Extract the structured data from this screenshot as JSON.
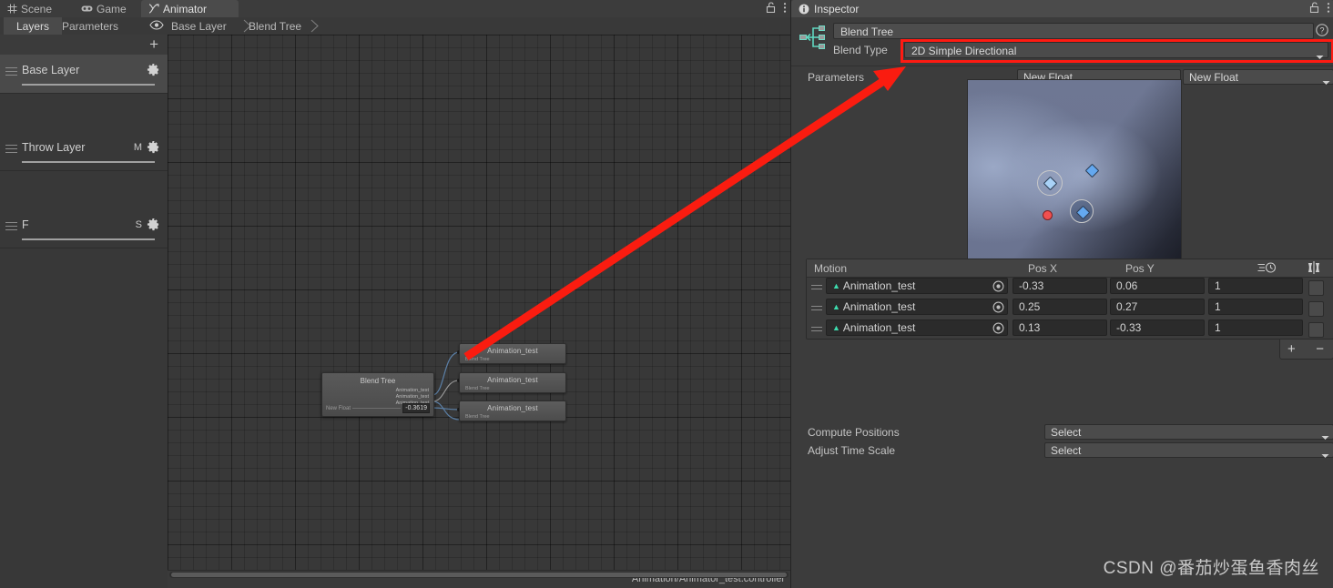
{
  "animator_window": {
    "tabs": [
      {
        "label": "Scene",
        "icon": "grid-icon",
        "active": false
      },
      {
        "label": "Game",
        "icon": "gamepad-icon",
        "active": false
      },
      {
        "label": "Animator",
        "icon": "animator-icon",
        "active": true
      }
    ],
    "right_icons": [
      "lock-icon",
      "kebab-menu-icon"
    ],
    "subtabs": [
      {
        "label": "Layers",
        "active": true
      },
      {
        "label": "Parameters",
        "active": false
      }
    ],
    "eye_icon": "eye-icon",
    "breadcrumb": [
      "Base Layer",
      "Blend Tree"
    ],
    "add_layer_label": "+",
    "layers": [
      {
        "name": "Base Layer",
        "badge": "",
        "selected": true
      },
      {
        "name": "Throw Layer",
        "badge": "M",
        "selected": false
      },
      {
        "name": "F",
        "badge": "S",
        "selected": false
      }
    ],
    "status_path": "Animation/Animator_test.controller",
    "graph": {
      "blend_tree_node": {
        "title": "Blend Tree",
        "outputs": [
          "Animation_test",
          "Animation_test",
          "Animation_test"
        ],
        "param_name": "New Float",
        "param_value": "-0.3619"
      },
      "state_nodes": [
        {
          "title": "Animation_test",
          "subtitle": "Blend Tree"
        },
        {
          "title": "Animation_test",
          "subtitle": "Blend Tree"
        },
        {
          "title": "Animation_test",
          "subtitle": "Blend Tree"
        }
      ]
    }
  },
  "inspector": {
    "tab_label": "Inspector",
    "tab_icon": "info-icon",
    "right_icons": [
      "lock-icon",
      "kebab-menu-icon"
    ],
    "object_icon": "blend-tree-icon",
    "name_value": "Blend Tree",
    "help_icon": "help-icon",
    "blend_type_label": "Blend Type",
    "blend_type_value": "2D Simple Directional",
    "blend_type_highlight_color": "#fe1a12",
    "parameters_label": "Parameters",
    "parameter_x": "New Float",
    "parameter_y": "New Float",
    "blend_graph": {
      "base_color": "#6d7692",
      "points": [
        {
          "x": -0.33,
          "y": 0.06,
          "kind": "selected",
          "screen_x": 0.38,
          "screen_y": 0.49
        },
        {
          "x": 0.25,
          "y": 0.27,
          "kind": "plain",
          "screen_x": 0.575,
          "screen_y": 0.405
        },
        {
          "x": 0.13,
          "y": -0.33,
          "kind": "filled",
          "screen_x": 0.535,
          "screen_y": 0.625
        }
      ],
      "cursor": {
        "color": "#f05050",
        "screen_x": 0.365,
        "screen_y": 0.635
      }
    },
    "motion_table": {
      "columns": [
        "Motion",
        "Pos X",
        "Pos Y",
        "time-scale-icon",
        "mirror-icon"
      ],
      "rows": [
        {
          "motion": "Animation_test",
          "pos_x": "-0.33",
          "pos_y": "0.06",
          "time_scale": "1",
          "mirror": false
        },
        {
          "motion": "Animation_test",
          "pos_x": "0.25",
          "pos_y": "0.27",
          "time_scale": "1",
          "mirror": false
        },
        {
          "motion": "Animation_test",
          "pos_x": "0.13",
          "pos_y": "-0.33",
          "time_scale": "1",
          "mirror": false
        }
      ],
      "add_label": "+",
      "remove_label": "−"
    },
    "options": [
      {
        "label": "Compute Positions",
        "value": "Select"
      },
      {
        "label": "Adjust Time Scale",
        "value": "Select"
      }
    ]
  },
  "watermark": "CSDN @番茄炒蛋鱼香肉丝"
}
